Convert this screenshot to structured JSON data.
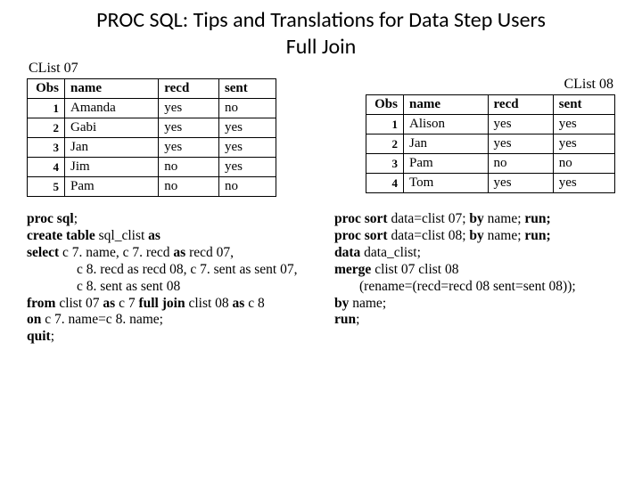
{
  "title_line1": "PROC SQL: Tips and Translations for Data Step Users",
  "title_line2": "Full Join",
  "left_caption": "CList 07",
  "right_caption": "CList 08",
  "headers": {
    "obs": "Obs",
    "name": "name",
    "recd": "recd",
    "sent": "sent"
  },
  "left_rows": [
    {
      "obs": "1",
      "name": "Amanda",
      "recd": "yes",
      "sent": "no"
    },
    {
      "obs": "2",
      "name": "Gabi",
      "recd": "yes",
      "sent": "yes"
    },
    {
      "obs": "3",
      "name": "Jan",
      "recd": "yes",
      "sent": "yes"
    },
    {
      "obs": "4",
      "name": "Jim",
      "recd": "no",
      "sent": "yes"
    },
    {
      "obs": "5",
      "name": "Pam",
      "recd": "no",
      "sent": "no"
    }
  ],
  "right_rows": [
    {
      "obs": "1",
      "name": "Alison",
      "recd": "yes",
      "sent": "yes"
    },
    {
      "obs": "2",
      "name": "Jan",
      "recd": "yes",
      "sent": "yes"
    },
    {
      "obs": "3",
      "name": "Pam",
      "recd": "no",
      "sent": "no"
    },
    {
      "obs": "4",
      "name": "Tom",
      "recd": "yes",
      "sent": "yes"
    }
  ],
  "sql": {
    "l1a": "proc sql",
    "l1b": ";",
    "l2a": "create table",
    "l2b": " sql_clist ",
    "l2c": "as",
    "l3a": "select",
    "l3b": " c 7. name, c 7. recd ",
    "l3c": "as",
    "l3d": " recd 07,",
    "l4": "c 8. recd as recd 08,   c 7. sent as sent 07,",
    "l5": "c 8. sent as sent 08",
    "l6a": "from",
    "l6b": " clist 07 ",
    "l6c": "as",
    "l6d": " c 7 ",
    "l6e": " full join ",
    "l6f": " clist 08 ",
    "l6g": "as",
    "l6h": " c 8",
    "l7a": "on",
    "l7b": " c 7. name=c 8. name;",
    "l8a": "quit",
    "l8b": ";"
  },
  "ds": {
    "l1a": "proc sort",
    "l1b": " data=clist 07; ",
    "l1c": "by",
    "l1d": " name; ",
    "l1e": "run;",
    "l2a": "proc sort",
    "l2b": " data=clist 08; ",
    "l2c": "by",
    "l2d": " name; ",
    "l2e": "run;",
    "l3a": "data",
    "l3b": " data_clist;",
    "l4a": "merge",
    "l4b": " clist 07 clist 08",
    "l5": "(rename=(recd=recd 08 sent=sent 08));",
    "l6a": "by",
    "l6b": " name;",
    "l7a": "run",
    "l7b": ";"
  }
}
